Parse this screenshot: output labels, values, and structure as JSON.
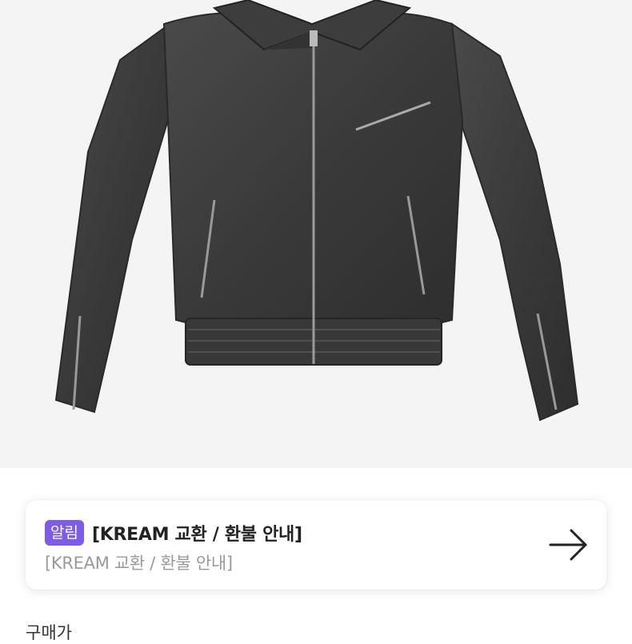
{
  "product": {
    "image_alt": "black leather jacket",
    "background_color": "#f4f4f4"
  },
  "notice": {
    "badge": "알림",
    "title": "[KREAM 교환 / 환불 안내]",
    "subtitle": "[KREAM 교환 / 환불 안내]",
    "arrow_icon": "arrow-right-icon",
    "badge_color": "#7d5ce8"
  },
  "next_section": {
    "label": "구매가"
  }
}
